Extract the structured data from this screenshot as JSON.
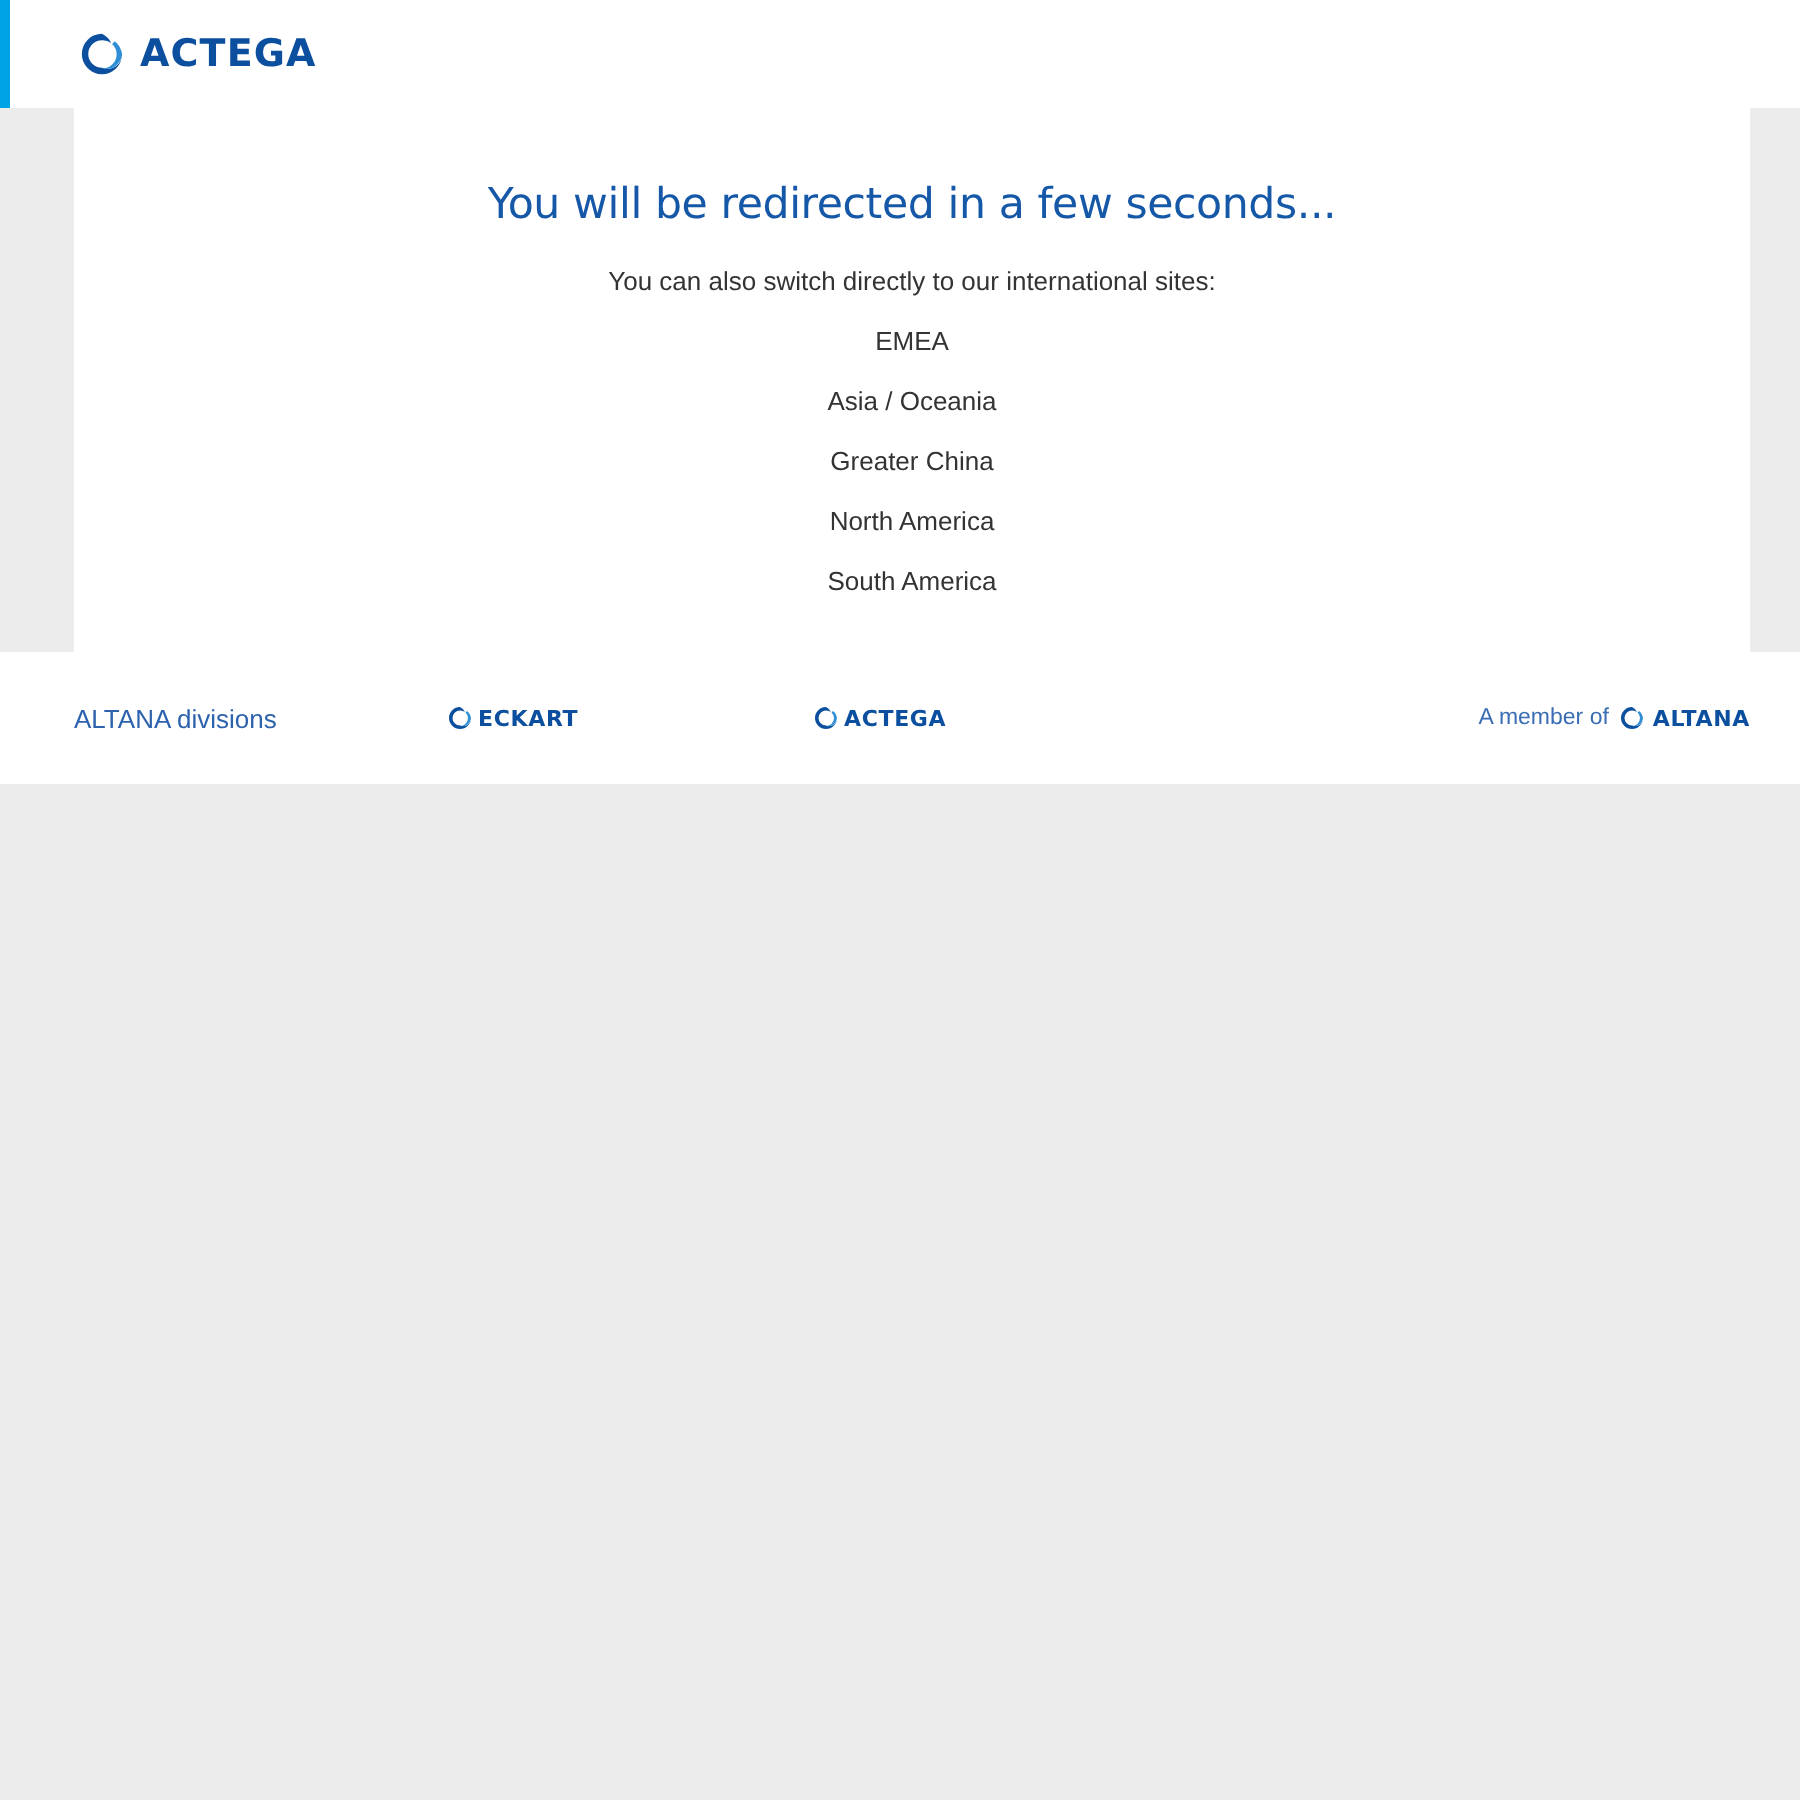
{
  "header": {
    "logo": {
      "text": "ACTEGA"
    }
  },
  "redirect": {
    "title": "You will be redirected in a few seconds...",
    "subtitle": "You can also switch directly to our international sites:",
    "sites": [
      "EMEA",
      "Asia / Oceania",
      "Greater China",
      "North America",
      "South America"
    ]
  },
  "footer": {
    "label": "ALTANA divisions",
    "divisions": [
      "ECKART",
      "ACTEGA"
    ],
    "member_text": "A member of",
    "member_logo": "ALTANA"
  }
}
